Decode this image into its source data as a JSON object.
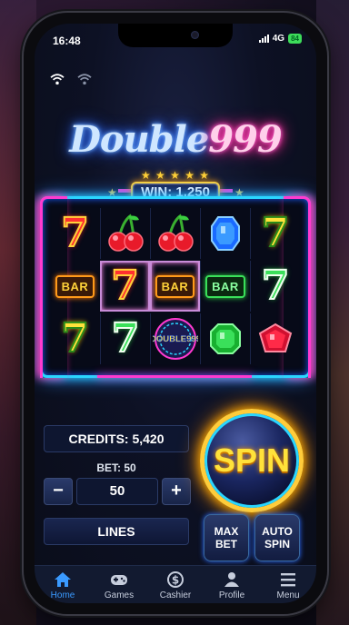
{
  "status": {
    "time": "16:48",
    "network": "4G",
    "battery": "84"
  },
  "game": {
    "title_part1": "Double",
    "title_part2": "999",
    "win_label": "WIN: 1,250",
    "reels": [
      [
        "seven-red",
        "cherry",
        "cherry",
        "sapphire",
        "seven-yellow"
      ],
      [
        "bar-orange",
        "seven-red",
        "bar-orange",
        "bar-green",
        "seven-green"
      ],
      [
        "seven-yellow",
        "seven-green",
        "double999-logo",
        "emerald",
        "ruby"
      ]
    ],
    "bar_text": "BAR",
    "seven_text": "7",
    "mini_logo": "DOUBLE999"
  },
  "controls": {
    "credits": "CREDITS: 5,420",
    "bet_label": "BET: 50",
    "bet_value": "50",
    "minus": "−",
    "plus": "+",
    "lines": "LINES",
    "spin": "SPIN",
    "max_bet": "MAX BET",
    "auto_spin": "AUTO SPIN"
  },
  "tabs": [
    {
      "label": "Home",
      "icon": "home-icon",
      "active": true
    },
    {
      "label": "Games",
      "icon": "gamepad-icon",
      "active": false
    },
    {
      "label": "Cashier",
      "icon": "dollar-coin-icon",
      "active": false
    },
    {
      "label": "Profile",
      "icon": "user-icon",
      "active": false
    },
    {
      "label": "Menu",
      "icon": "menu-icon",
      "active": false
    }
  ],
  "colors": {
    "accent": "#3a9aff",
    "neon_blue": "#2ad6ff",
    "neon_pink": "#ff3ad0",
    "gold": "#ffcc3a"
  }
}
